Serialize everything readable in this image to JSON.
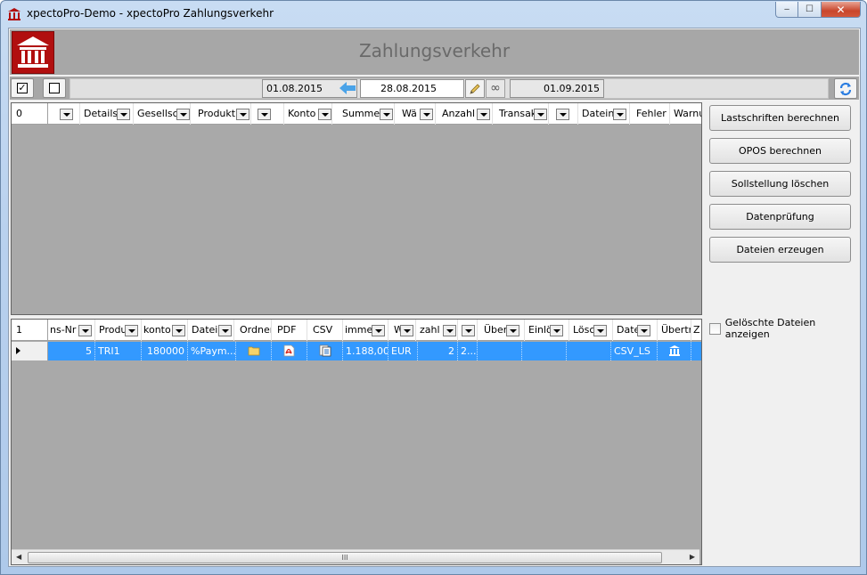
{
  "window": {
    "title": "xpectoPro-Demo - xpectoPro Zahlungsverkehr",
    "controls": {
      "minimize": "‒",
      "maximize": "☐",
      "close": "✕"
    }
  },
  "header": {
    "title": "Zahlungsverkehr",
    "logo_icon": "bank-icon"
  },
  "toolbar": {
    "check_all_glyph": "☑",
    "uncheck_all_glyph": "☐",
    "date_from": "01.08.2015",
    "date_current": "28.08.2015",
    "date_to": "01.09.2015",
    "infinity": "∞",
    "refresh_icon": "refresh-icon"
  },
  "top_grid": {
    "row_count": "0",
    "columns": [
      "",
      "Details",
      "Gesellsc",
      "Produkt",
      "",
      "Konto",
      "Summe",
      "Wä",
      "Anzahl",
      "Transak",
      "",
      "Dateina",
      "Fehler",
      "Warnu"
    ]
  },
  "bottom_grid": {
    "row_count": "1",
    "columns": [
      "ns-Nr",
      "Produ",
      "konto",
      "Datei",
      "Ordner",
      "PDF",
      "CSV",
      "imme",
      "W",
      "zahl",
      "",
      "Über",
      "Einlö",
      "Lösc",
      "Date",
      "Übertra",
      "Z"
    ],
    "rows": [
      {
        "nr": "5",
        "produkt": "TRI1",
        "konto": "180000",
        "datei": "%Paym...",
        "summe": "1.188,00",
        "waehrung": "EUR",
        "anzahl": "2",
        "extra": "2...",
        "dateityp": "CSV_LS"
      }
    ],
    "scroll_grip": "III"
  },
  "actions": {
    "lastschriften": "Lastschriften berechnen",
    "opos": "OPOS berechnen",
    "sollstellung": "Sollstellung löschen",
    "datenpruefung": "Datenprüfung",
    "dateien": "Dateien erzeugen",
    "show_deleted": "Gelöschte Dateien anzeigen"
  },
  "colors": {
    "selection": "#3399ff",
    "grid_bg": "#a9a9a9",
    "brand": "#b10f0f"
  }
}
